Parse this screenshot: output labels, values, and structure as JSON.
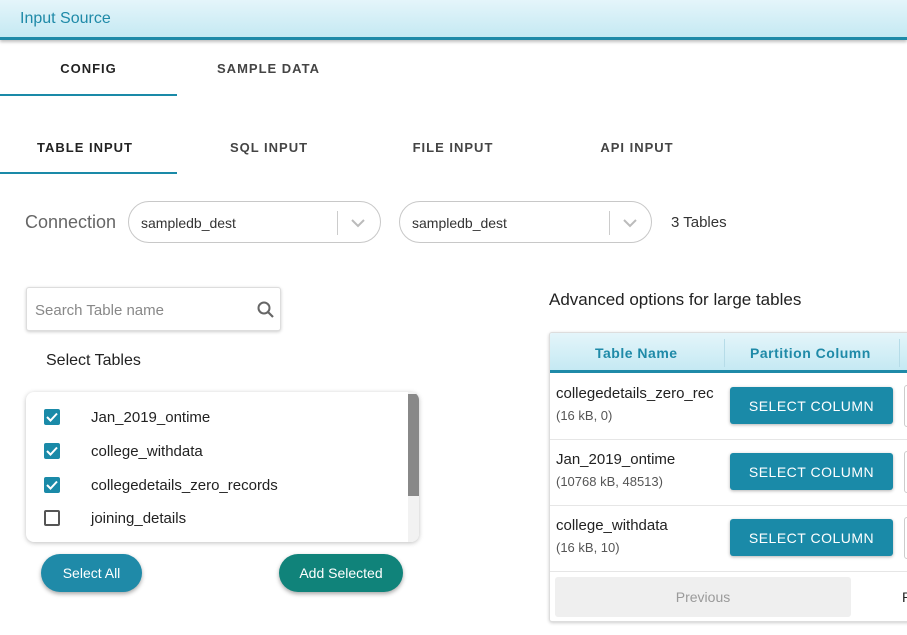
{
  "header": {
    "title": "Input Source"
  },
  "main_tabs": [
    {
      "label": "CONFIG",
      "active": true
    },
    {
      "label": "SAMPLE DATA",
      "active": false
    }
  ],
  "input_tabs": [
    {
      "label": "TABLE INPUT",
      "active": true
    },
    {
      "label": "SQL INPUT",
      "active": false
    },
    {
      "label": "FILE INPUT",
      "active": false
    },
    {
      "label": "API INPUT",
      "active": false
    }
  ],
  "connection": {
    "label": "Connection",
    "select1_value": "sampledb_dest",
    "select2_value": "sampledb_dest",
    "tables_count": "3 Tables"
  },
  "search": {
    "placeholder": "Search Table name",
    "value": ""
  },
  "select_tables": {
    "label": "Select Tables",
    "items": [
      {
        "label": "Jan_2019_ontime",
        "checked": true
      },
      {
        "label": "college_withdata",
        "checked": true
      },
      {
        "label": "collegedetails_zero_records",
        "checked": true
      },
      {
        "label": "joining_details",
        "checked": false
      }
    ]
  },
  "buttons": {
    "select_all": "Select All",
    "add_selected": "Add Selected"
  },
  "advanced": {
    "title": "Advanced options for large tables",
    "columns": [
      "Table Name",
      "Partition Column"
    ],
    "rows": [
      {
        "name": "collegedetails_zero_rec",
        "meta": "(16 kB, 0)",
        "button": "SELECT COLUMN"
      },
      {
        "name": "Jan_2019_ontime",
        "meta": "(10768 kB, 48513)",
        "button": "SELECT COLUMN"
      },
      {
        "name": "college_withdata",
        "meta": "(16 kB, 10)",
        "button": "SELECT COLUMN"
      }
    ],
    "previous": "Previous",
    "next_partial": "P"
  },
  "colors": {
    "accent": "#1a8aa8",
    "add_button": "#10837a",
    "header_bg": "#c5e9f3"
  },
  "icons": {
    "search": "search-icon",
    "chevron": "chevron-down-icon",
    "checkbox_checked": "checkbox-checked-icon"
  }
}
